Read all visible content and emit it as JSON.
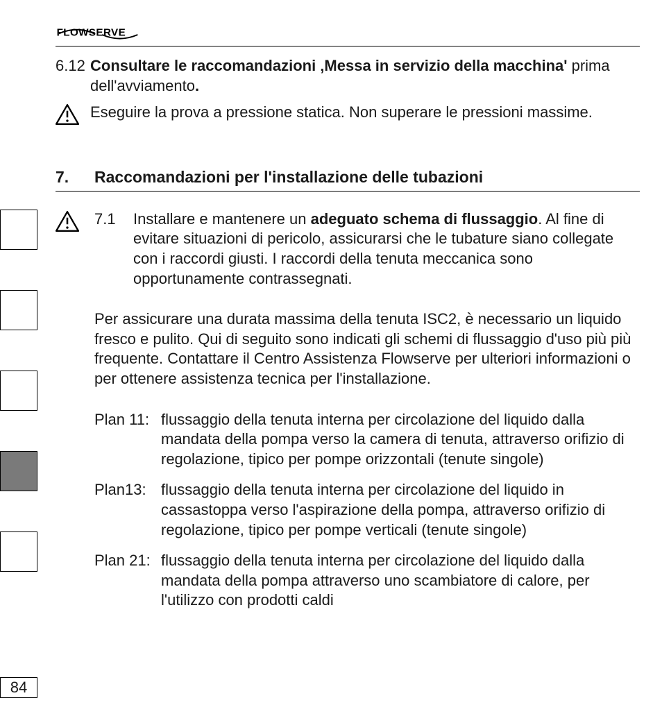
{
  "brand": "FLOWSERVE",
  "page_number": "84",
  "section612": {
    "num": "6.12",
    "bold_lead": "Consultare le raccomandazioni ‚Messa in servizio della mac­china'",
    "rest": " prima dell'avviamento",
    "period": "."
  },
  "warn612": "Eseguire la prova a pressione statica. Non superare le pressioni massime.",
  "section7": {
    "num": "7.",
    "title": "Raccomandazioni per l'installazione delle tubazioni"
  },
  "section71": {
    "num": "7.1",
    "lead": "Installare e mantenere un ",
    "bold": "adeguato schema di flussaggio",
    "rest": ". Al fine di evitare situazioni di pericolo, assicurarsi che le tubature siano collegate con i raccordi giusti. I raccordi della tenuta meccanica sono opportunamente contrassegnati."
  },
  "para": "Per assicurare una durata massima della tenuta ISC2, è neces­sario un liquido fresco e pulito. Qui di seguito sono indicati gli schemi di flussaggio d'uso più più frequente. Contattare il Centro Assistenza Flowserve per ulteriori informazioni o per ottenere assistenza tecnica per l'installazione.",
  "plans": [
    {
      "label": "Plan 11:",
      "text": "flussaggio della tenuta interna per circolazione del liquido dalla mandata della pompa verso la camera di tenuta, attraverso orifizio di regolazione, tipico per pompe orizzontali (tenute singole)"
    },
    {
      "label": "Plan13:",
      "text": "flussaggio della tenuta interna per circolazione del liquido in cassastoppa verso l'aspirazione della pompa, attraverso orifizio di regolazione, tipico per pompe verticali (tenute singole)"
    },
    {
      "label": "Plan 21:",
      "text": "flussaggio della tenuta interna per circolazione del liquido dalla mandata della pompa attraverso uno scambiatore di calore, per l'utilizzo con prodotti caldi"
    }
  ]
}
